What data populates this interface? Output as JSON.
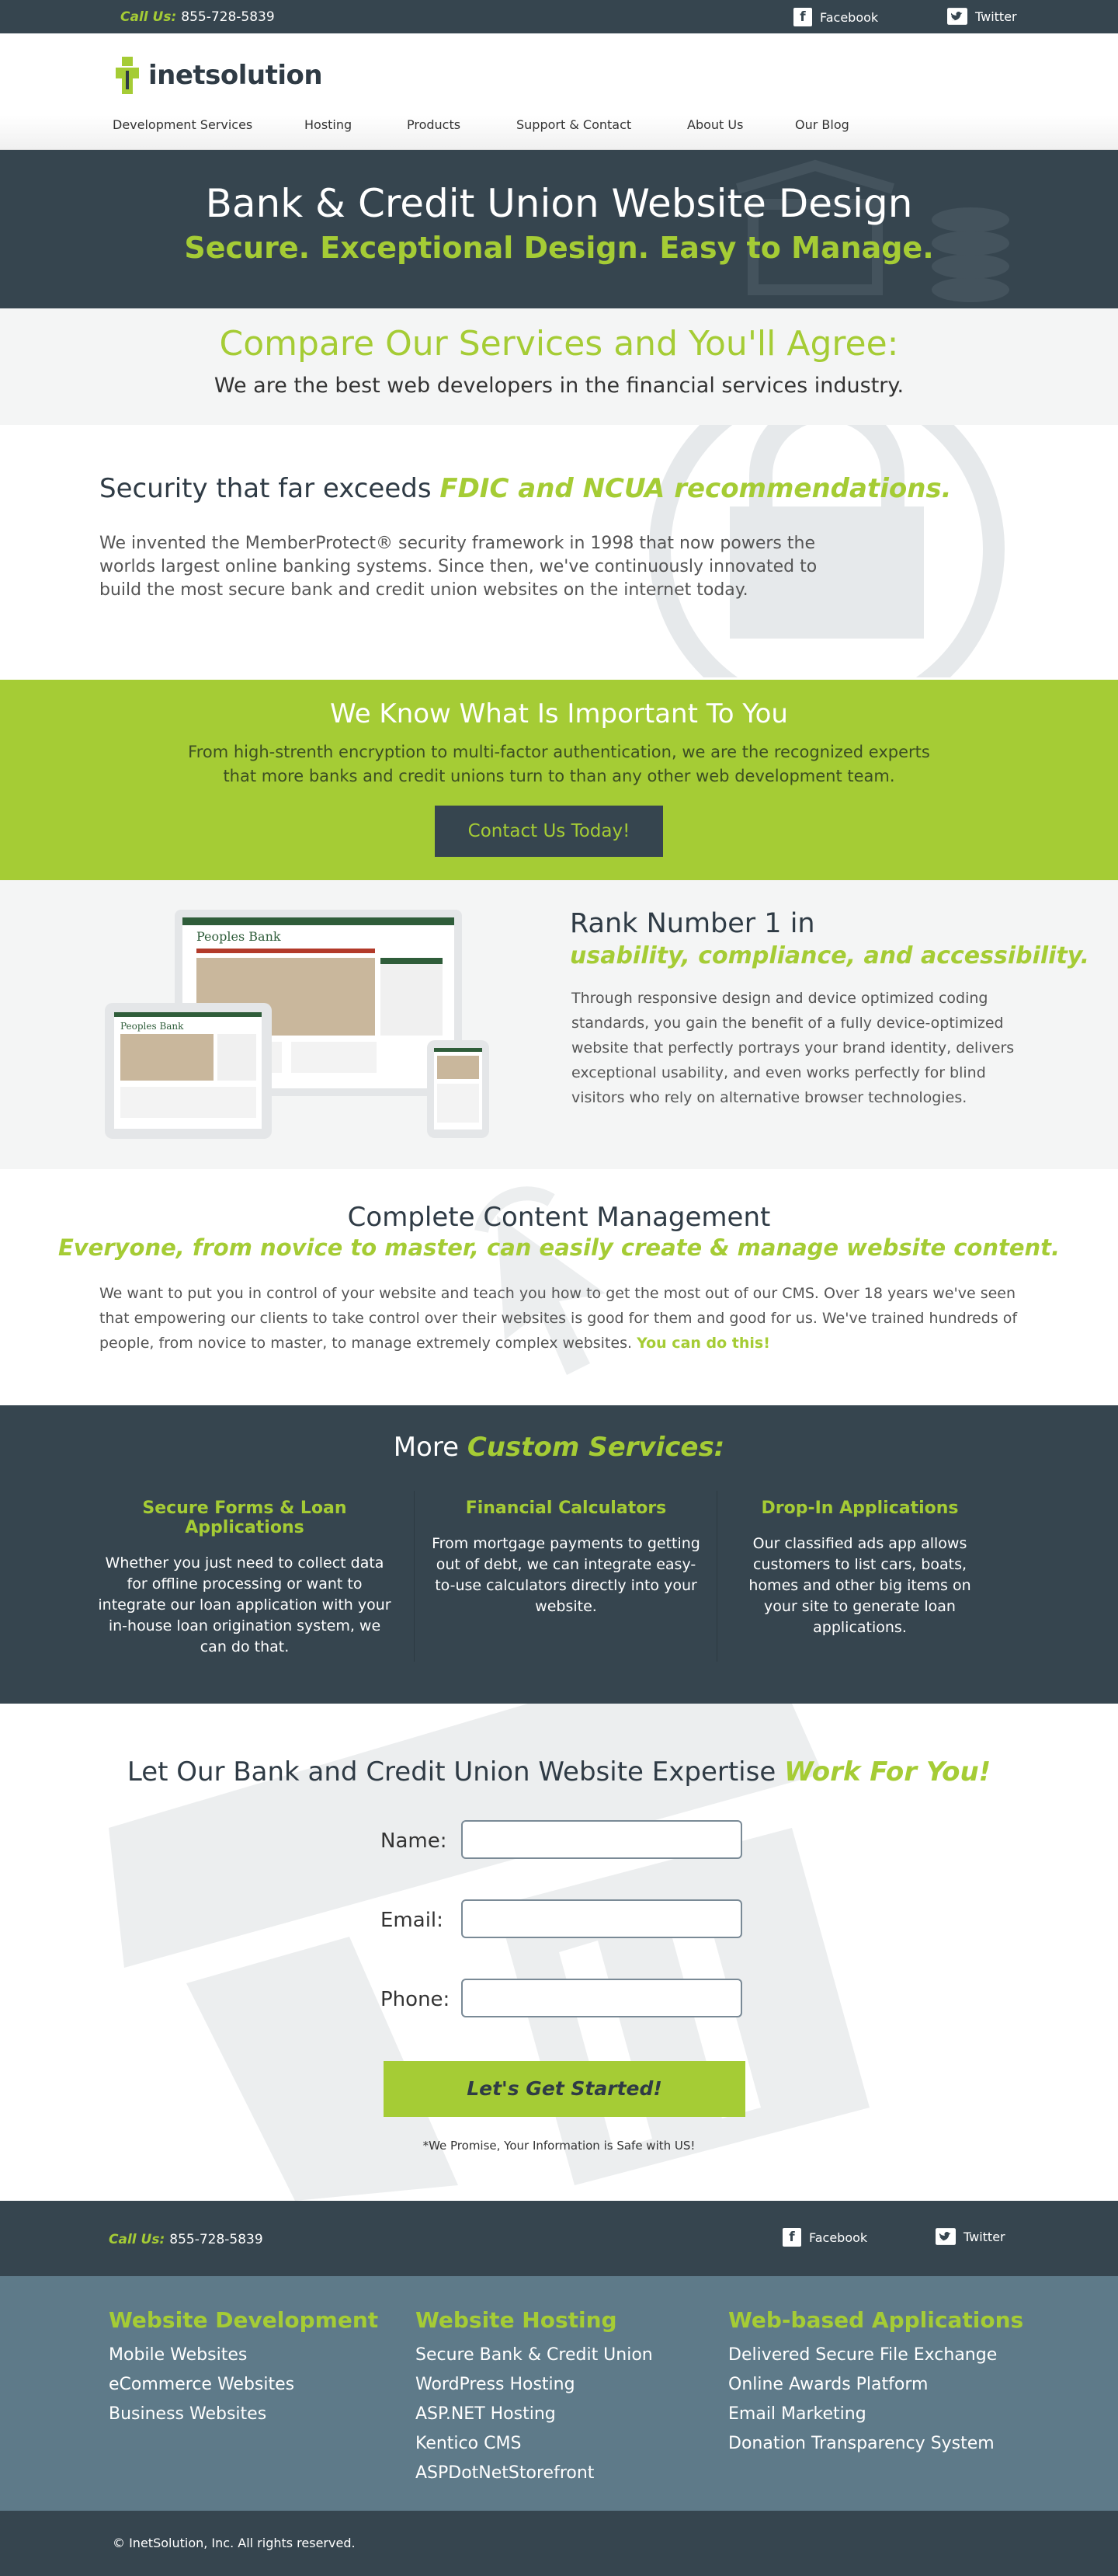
{
  "topbar": {
    "call_label": "Call Us:",
    "phone": "855-728-5839",
    "facebook": "Facebook",
    "twitter": "Twitter"
  },
  "header": {
    "logo_text": "inetsolution",
    "nav": [
      "Development Services",
      "Hosting",
      "Products",
      "Support & Contact",
      "About Us",
      "Our Blog"
    ]
  },
  "hero": {
    "title": "Bank & Credit Union Website Design",
    "subtitle": "Secure. Exceptional Design. Easy to Manage."
  },
  "compare": {
    "title": "Compare Our Services and You'll Agree:",
    "text": "We are the best web developers in the financial services industry."
  },
  "security": {
    "title_plain": "Security that far exceeds",
    "title_em": "FDIC and NCUA recommendations.",
    "text": "We invented the MemberProtect® security framework in 1998 that now powers the worlds largest online banking systems. Since then, we've continuously innovated to build the most secure bank and credit union websites on the internet today."
  },
  "important": {
    "title": "We Know What Is Important To You",
    "text": "From high-strenth encryption to multi-factor authentication, we are the recognized experts that more banks and credit unions turn to than any other web development team.",
    "button": "Contact Us Today!"
  },
  "rank": {
    "title": "Rank Number 1 in",
    "subtitle": "usability, compliance, and accessibility.",
    "text": "Through responsive design and device optimized coding standards, you gain the benefit of a fully device-optimized website that perfectly portrays your brand identity, delivers exceptional usability, and even works perfectly for blind visitors who rely on alternative browser technologies.",
    "mock_bank_name": "Peoples Bank"
  },
  "cms": {
    "title": "Complete Content Management",
    "subtitle": "Everyone, from novice to master, can easily create & manage website content.",
    "text": "We want to put you in control of your website and teach you how to get the most out of our CMS. Over 18 years we've seen that empowering our clients to take control over their websites is good for them and good for us. We've trained hundreds of people, from novice to master, to manage extremely complex websites.",
    "text_em": "You can do this!"
  },
  "services": {
    "title_plain": "More",
    "title_em": "Custom Services:",
    "items": [
      {
        "title": "Secure  Forms & Loan Applications",
        "text": "Whether you just need to collect data for offline processing or want to integrate our loan application with your in-house loan origination system, we can do that."
      },
      {
        "title": "Financial Calculators",
        "text": "From mortgage payments to getting out of debt, we can integrate easy-to-use calculators directly into your website."
      },
      {
        "title": "Drop-In Applications",
        "text": "Our classified ads app allows customers to list cars, boats, homes and other big items on your site to generate loan applications."
      }
    ]
  },
  "form": {
    "title_plain": "Let Our Bank and Credit Union Website Expertise",
    "title_em": "Work For You!",
    "name_label": "Name:",
    "email_label": "Email:",
    "phone_label": "Phone:",
    "button": "Let's Get Started!",
    "promise": "*We Promise, Your Information is Safe with US!"
  },
  "bottombar": {
    "call_label": "Call Us:",
    "phone": "855-728-5839",
    "facebook": "Facebook",
    "twitter": "Twitter"
  },
  "footer": {
    "columns": [
      {
        "title": "Website Development",
        "links": [
          "Mobile Websites",
          "eCommerce Websites",
          "Business Websites"
        ]
      },
      {
        "title": "Website Hosting",
        "links": [
          "Secure Bank & Credit Union",
          "WordPress Hosting",
          "ASP.NET Hosting",
          "Kentico CMS",
          "ASPDotNetStorefront"
        ]
      },
      {
        "title": "Web-based Applications",
        "links": [
          "Delivered Secure File Exchange",
          "Online Awards Platform",
          "Email Marketing",
          "Donation Transparency System"
        ]
      }
    ],
    "copyright": "© InetSolution, Inc. All rights reserved."
  },
  "colors": {
    "dark": "#36454f",
    "accent": "#a5cc35",
    "footer_bg": "#5e7a89",
    "light_bg": "#f4f5f5"
  }
}
